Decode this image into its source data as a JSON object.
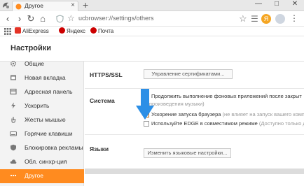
{
  "browser": {
    "tab_title": "Другое",
    "tab_close": "×",
    "new_tab": "+",
    "url": "ucbrowser://settings/others",
    "win_min": "—",
    "win_max": "□",
    "win_close": "✕",
    "nav_back": "‹",
    "nav_forward": "›",
    "nav_reload": "↻",
    "nav_home": "⌂",
    "menu": "⋮"
  },
  "bookmarks": [
    {
      "label": "AliExpress",
      "icon": "aliexpress-icon",
      "color": "#e43225"
    },
    {
      "label": "Яндекс",
      "icon": "yandex-icon",
      "color": "#cc0000"
    },
    {
      "label": "Почта",
      "icon": "mail-icon",
      "color": "#cc0000"
    }
  ],
  "page": {
    "title": "Настройки"
  },
  "sidebar": {
    "items": [
      {
        "label": "Общие",
        "icon": "gear-icon"
      },
      {
        "label": "Новая вкладка",
        "icon": "new-tab-icon"
      },
      {
        "label": "Адресная панель",
        "icon": "address-bar-icon"
      },
      {
        "label": "Ускорить",
        "icon": "lightning-icon"
      },
      {
        "label": "Жесты мышью",
        "icon": "mouse-gesture-icon"
      },
      {
        "label": "Горячие клавиши",
        "icon": "keyboard-icon"
      },
      {
        "label": "Блокировка рекламы",
        "icon": "adblock-icon"
      },
      {
        "label": "Обл. синхр-ция",
        "icon": "cloud-icon"
      },
      {
        "label": "Другое",
        "icon": "dots-icon",
        "active": true
      }
    ]
  },
  "sections": {
    "https": {
      "label": "HTTPS/SSL",
      "button": "Управление сертификатами..."
    },
    "system": {
      "label": "Система",
      "options": [
        {
          "text": "Продолжить выполнение фоновых приложений после закрыт",
          "hint_line2": "оспроизведения музыки)",
          "checked": false
        },
        {
          "text": "Ускорение запуска браузера",
          "hint": "(не влияет на запуск вашего комп",
          "checked": true
        },
        {
          "text": "Используйте EDGE в совместимом режиме",
          "hint": "(Доступно только д",
          "checked": false
        }
      ]
    },
    "languages": {
      "label": "Языки",
      "button": "Изменить языковые настройки..."
    }
  },
  "colors": {
    "accent": "#ff8b1f",
    "arrow": "#2c8fe6"
  }
}
